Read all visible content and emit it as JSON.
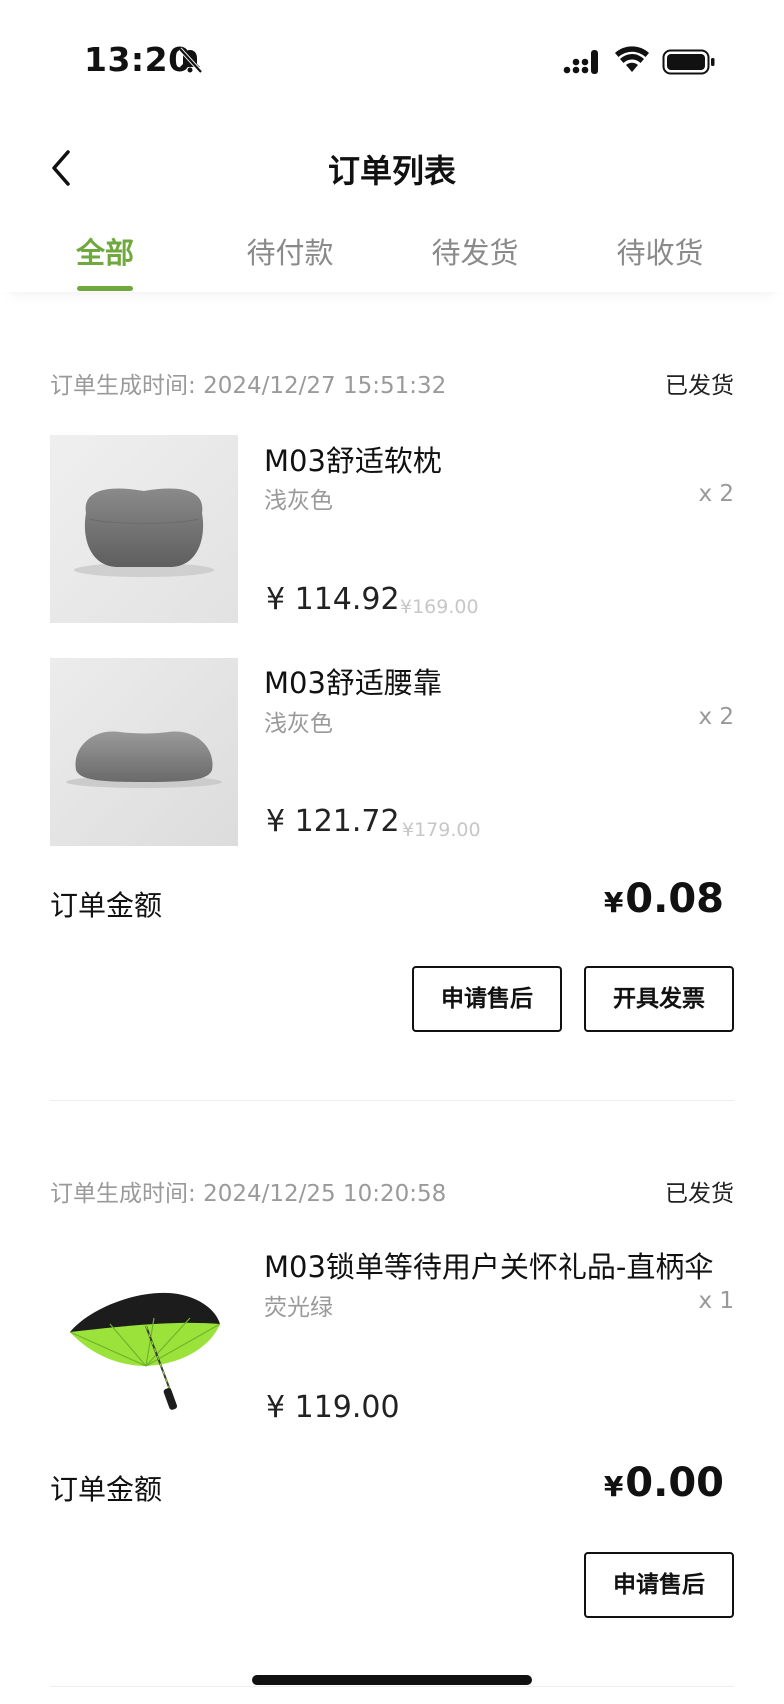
{
  "status_bar": {
    "time": "13:20"
  },
  "nav": {
    "title": "订单列表"
  },
  "tabs": [
    {
      "label": "全部",
      "active": true
    },
    {
      "label": "待付款",
      "active": false
    },
    {
      "label": "待发货",
      "active": false
    },
    {
      "label": "待收货",
      "active": false
    }
  ],
  "colors": {
    "accent": "#6fa93e",
    "umbrella": "#9be23a"
  },
  "orders": [
    {
      "time_label": "订单生成时间:",
      "time": "2024/12/27 15:51:32",
      "status": "已发货",
      "items": [
        {
          "name": "M03舒适软枕",
          "variant": "浅灰色",
          "qty": "x 2",
          "price": "¥ 114.92",
          "original_price": "¥169.00",
          "icon": "pillow-image"
        },
        {
          "name": "M03舒适腰靠",
          "variant": "浅灰色",
          "qty": "x 2",
          "price": "¥ 121.72",
          "original_price": "¥179.00",
          "icon": "lumbar-pillow-image"
        }
      ],
      "amount_label": "订单金额",
      "amount_currency": "¥",
      "amount": "0.08",
      "buttons": [
        "申请售后",
        "开具发票"
      ]
    },
    {
      "time_label": "订单生成时间:",
      "time": "2024/12/25 10:20:58",
      "status": "已发货",
      "items": [
        {
          "name": "M03锁单等待用户关怀礼品-直柄伞",
          "variant": "荧光绿",
          "qty": "x 1",
          "price": "¥ 119.00",
          "original_price": "",
          "icon": "umbrella-image"
        }
      ],
      "amount_label": "订单金额",
      "amount_currency": "¥",
      "amount": "0.00",
      "buttons": [
        "申请售后"
      ]
    }
  ]
}
